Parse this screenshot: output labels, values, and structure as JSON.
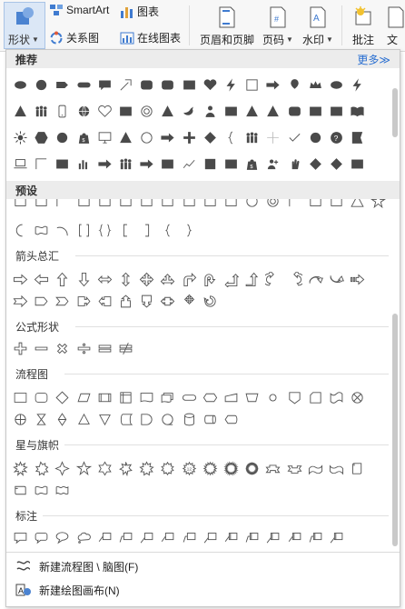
{
  "ribbon": {
    "shape_label": "形状",
    "smartart_label": "SmartArt",
    "chart_label": "图表",
    "relation_label": "关系图",
    "online_chart_label": "在线图表",
    "header_footer_label": "页眉和页脚",
    "page_number_label": "页码",
    "watermark_label": "水印",
    "comment_label": "批注",
    "text_label": "文"
  },
  "panel": {
    "recommend_label": "推荐",
    "more_label": "更多≫",
    "preset_label": "预设",
    "categories": {
      "arrows": "箭头总汇",
      "formula": "公式形状",
      "flowchart": "流程图",
      "stars": "星与旗帜",
      "callouts": "标注"
    },
    "footer": {
      "new_flowchart": "新建流程图 \\ 脑图(F)",
      "new_canvas": "新建绘图画布(N)"
    }
  },
  "icons": {
    "recommend_row1": [
      "ellipse",
      "circle",
      "tag",
      "capsule",
      "speech",
      "arrow-diag",
      "rounded-rect",
      "rounded-rect",
      "rect",
      "heart",
      "lightning",
      "square-outline",
      "arrow-right",
      "balloon",
      "crown",
      "ellipse",
      "lightning"
    ],
    "recommend_row2": [
      "triangle",
      "people",
      "phone",
      "globe",
      "heart-outline",
      "rect",
      "ring",
      "triangle",
      "bird",
      "person",
      "rect",
      "triangle",
      "triangle",
      "rounded-rect",
      "rect",
      "rect",
      "book"
    ],
    "recommend_row3": [
      "sun",
      "hexagon",
      "circle",
      "bag",
      "monitor",
      "triangle",
      "circle-outline",
      "arrow-right",
      "plus",
      "diamond",
      "brace",
      "people",
      "plus-thin",
      "check",
      "circle",
      "help",
      "flag"
    ],
    "recommend_row4": [
      "laptop",
      "corner",
      "rect",
      "chart",
      "arrow-right",
      "people",
      "arrow-right",
      "rect",
      "line-chart",
      "square",
      "rect",
      "bag",
      "person-plus",
      "hand",
      "diamond",
      "diamond",
      "rect"
    ],
    "preset_row1": [
      "rect-outline",
      "rect-outline",
      "corner",
      "rect-outline",
      "rect-outline",
      "rect-outline",
      "rect-outline",
      "rect-outline",
      "rect-outline",
      "rect-outline",
      "rect-outline",
      "circle-outline",
      "ring",
      "corner",
      "rect-outline",
      "rect-outline",
      "triangle-outline",
      "star-outline"
    ],
    "preset_row2": [
      "moon",
      "wave",
      "arc",
      "bracket-pair",
      "brace-pair",
      "bracket-left",
      "bracket-right",
      "brace-left",
      "brace-right"
    ],
    "arrows_row1": [
      "arrow-right",
      "arrow-left",
      "arrow-up",
      "arrow-down",
      "arrow-lr",
      "arrow-ud",
      "arrow-quad",
      "arrow-lru",
      "arrow-bent",
      "arrow-uturn",
      "arrow-left-up",
      "arrow-bent-up",
      "arrow-curved-right",
      "arrow-curved-left",
      "arrow-curved-up",
      "arrow-curved-down",
      "arrow-striped"
    ],
    "arrows_row2": [
      "arrow-notched",
      "pentagon",
      "chevron",
      "callout-right",
      "callout-left",
      "callout-up",
      "callout-down",
      "callout-lr",
      "callout-quad",
      "arrow-circular"
    ],
    "formula_row": [
      "plus",
      "minus",
      "times",
      "divide",
      "equal",
      "not-equal"
    ],
    "flow_row1": [
      "rect",
      "rounded-rect",
      "diamond",
      "parallelogram",
      "predefined",
      "internal",
      "document",
      "multidoc",
      "terminator",
      "preparation",
      "manual-input",
      "manual-op",
      "connector",
      "offpage",
      "card",
      "punched-tape",
      "sum"
    ],
    "flow_row2": [
      "or",
      "collate",
      "sort",
      "extract",
      "merge",
      "stored-data",
      "delay",
      "seq-storage",
      "magnetic-disk",
      "direct-storage",
      "display"
    ],
    "stars_row1": [
      "explosion1",
      "explosion2",
      "star4",
      "star5",
      "star6",
      "star7",
      "star8",
      "star10",
      "star12",
      "star16",
      "star24",
      "star32",
      "ribbon-up",
      "ribbon-down",
      "ribbon-curved-up",
      "ribbon-curved-down",
      "scroll-vertical"
    ],
    "stars_row2": [
      "scroll-horizontal",
      "wave",
      "double-wave"
    ],
    "callouts_row": [
      "callout-rect",
      "callout-round-rect",
      "callout-oval",
      "callout-cloud",
      "callout-line1",
      "callout-line2",
      "callout-line3",
      "callout-line4",
      "callout-line5",
      "callout-line6",
      "callout-line7",
      "callout-line8",
      "callout-line9",
      "callout-line10",
      "callout-line11",
      "callout-line12"
    ]
  }
}
